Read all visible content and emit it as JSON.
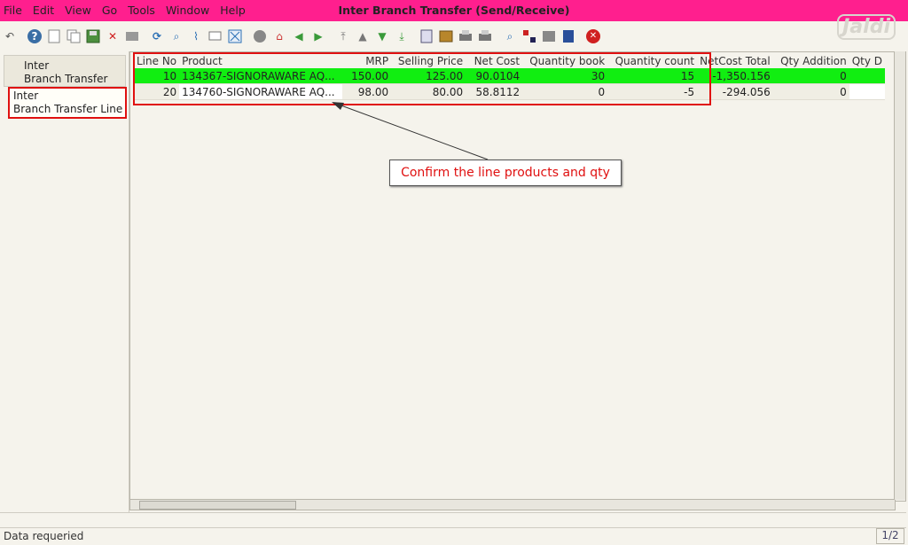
{
  "app": {
    "title": "Inter Branch Transfer (Send/Receive)",
    "watermark": "Jaldi"
  },
  "menu": [
    "File",
    "Edit",
    "View",
    "Go",
    "Tools",
    "Window",
    "Help"
  ],
  "toolbar_icons": [
    "undo-icon",
    "help-icon",
    "new-record-icon",
    "copy-record-icon",
    "save-icon",
    "delete-icon",
    "print-preview-icon",
    "refresh-icon",
    "find-icon",
    "attachment-icon",
    "chat-icon",
    "grid-toggle-icon",
    "history-icon",
    "home-icon",
    "back-icon",
    "forward-icon",
    "first-icon",
    "previous-icon",
    "next-icon",
    "last-icon",
    "report-icon",
    "archive-icon",
    "print-icon",
    "print-2-icon",
    "zoom-across-icon",
    "workflow-icon",
    "process-icon",
    "request-icon",
    "close-icon"
  ],
  "sidebar": {
    "tab_header": [
      "Inter",
      "Branch Transfer"
    ],
    "tab_line": [
      "Inter",
      "Branch Transfer Line"
    ]
  },
  "grid": {
    "columns": [
      "Line No",
      "Product",
      "MRP",
      "Selling Price",
      "Net Cost",
      "Quantity book",
      "Quantity count",
      "NetCost Total",
      "Qty Addition",
      "Qty D"
    ],
    "rows": [
      {
        "line": "10",
        "product": "134367-SIGNORAWARE AQ...",
        "mrp": "150.00",
        "selling": "125.00",
        "netcost": "90.0104",
        "qtybook": "30",
        "qtycount": "15",
        "total": "-1,350.156",
        "qtyadd": "0"
      },
      {
        "line": "20",
        "product": "134760-SIGNORAWARE AQ...",
        "mrp": "98.00",
        "selling": "80.00",
        "netcost": "58.8112",
        "qtybook": "0",
        "qtycount": "-5",
        "total": "-294.056",
        "qtyadd": "0"
      }
    ]
  },
  "annotation": {
    "text": "Confirm the line products and qty"
  },
  "status": {
    "message": "Data requeried",
    "pager": "1/2"
  },
  "colors": {
    "titlebar": "#ff1f8e",
    "selected_row": "#11ee11",
    "annotation": "#e01010"
  }
}
